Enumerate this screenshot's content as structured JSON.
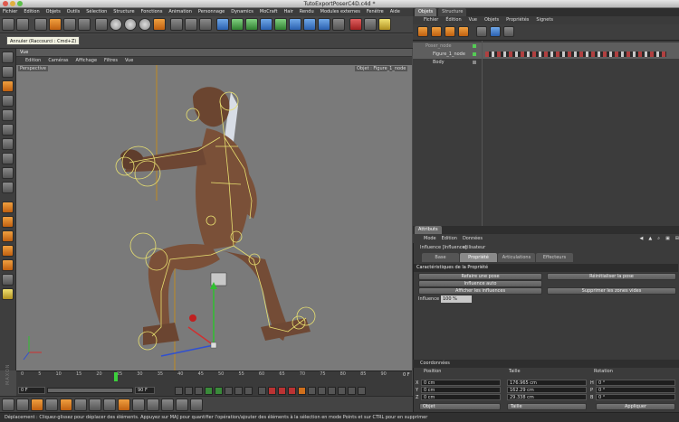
{
  "window": {
    "title": "TutoExportPoserC4D.c4d *"
  },
  "menu": [
    "Fichier",
    "Edition",
    "Objets",
    "Outils",
    "Sélection",
    "Structure",
    "Fonctions",
    "Animation",
    "Personnage",
    "Dynamics",
    "MoCraft",
    "Hair",
    "Rendu",
    "Modules externes",
    "Fenêtre",
    "Aide"
  ],
  "tooltip": "Annuler (Raccourci : Cmd+Z)",
  "viewport": {
    "panel_title": "Vue",
    "menu": [
      "Edition",
      "Caméras",
      "Affichage",
      "Filtres",
      "Vue"
    ],
    "view_label": "Perspective",
    "camera_label": "Objet : Figure_1_node"
  },
  "timeline": {
    "ticks": [
      "0",
      "5",
      "10",
      "15",
      "20",
      "25",
      "30",
      "35",
      "40",
      "45",
      "50",
      "55",
      "60",
      "65",
      "70",
      "75",
      "80",
      "85",
      "90"
    ],
    "current": "0 F",
    "start_field": "0 F",
    "end_field": "90 F"
  },
  "brand": "MAXON CINEMA 4D",
  "status": "Déplacement : Cliquez-glissez pour déplacer des éléments. Appuyez sur MAJ pour quantifier l'opération/ajouter des éléments à la sélection en mode Points et sur CTRL pour en supprimer",
  "objects": {
    "tabs": [
      "Objets",
      "Structure"
    ],
    "menu": [
      "Fichier",
      "Édition",
      "Vue",
      "Objets",
      "Propriétés",
      "Signets"
    ],
    "tree": [
      {
        "name": "Poser_node",
        "level": 0
      },
      {
        "name": "Figure_1_node",
        "level": 1
      },
      {
        "name": "Body",
        "level": 1
      }
    ]
  },
  "attributes": {
    "tabs": [
      "Attributs"
    ],
    "menu": [
      "Mode",
      "Edition",
      "Données utilisateur"
    ],
    "object": "Influence [Influence]",
    "subtabs": [
      "Base",
      "Propriété",
      "Articulations",
      "Effecteurs"
    ],
    "section": "Caractéristiques de la Propriété",
    "buttons": {
      "refaire_pose": "Refaire une pose",
      "reinit_pose": "Réinitialiser la pose",
      "influence_auto": "Influence auto",
      "afficher": "Afficher les influences",
      "supprimer": "Supprimer les zones vides"
    },
    "influence_label": "Influence",
    "influence_value": "100 %"
  },
  "coordinates": {
    "title": "Coordonnées",
    "cols": [
      "Position",
      "Taille",
      "Rotation"
    ],
    "rows": [
      {
        "axis": "X",
        "pos": "0 cm",
        "size": "176.965 cm",
        "rot_axis": "H",
        "rot": "0 °"
      },
      {
        "axis": "Y",
        "pos": "0 cm",
        "size": "162.29 cm",
        "rot_axis": "P",
        "rot": "0 °"
      },
      {
        "axis": "Z",
        "pos": "0 cm",
        "size": "29.338 cm",
        "rot_axis": "B",
        "rot": "0 °"
      }
    ],
    "mode": "Objet",
    "size_mode": "Taille",
    "apply": "Appliquer"
  }
}
